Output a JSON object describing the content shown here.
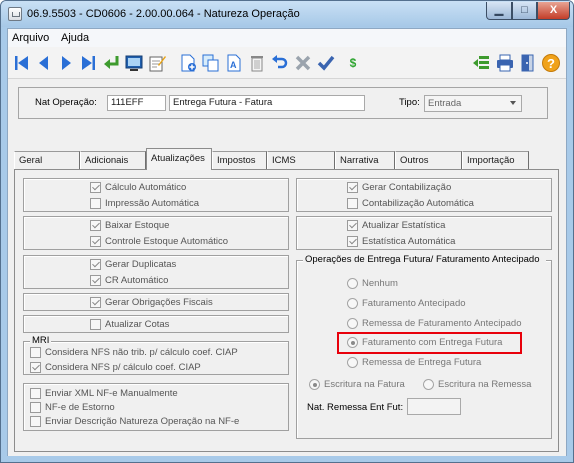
{
  "window": {
    "title": "06.9.5503 - CD0606 - 2.00.00.064 - Natureza Operação",
    "min_glyph": "▁",
    "max_glyph": "□",
    "close_glyph": "X"
  },
  "menu": {
    "arquivo": "Arquivo",
    "ajuda": "Ajuda"
  },
  "toolbar": {
    "icons": [
      "first-icon",
      "prev-icon",
      "next-icon",
      "last-icon",
      "return-icon",
      "screen-icon",
      "edit-icon",
      "new-icon",
      "copy-icon",
      "text-edit-icon",
      "delete-icon",
      "undo-icon",
      "cancel-icon",
      "confirm-icon",
      "currency-icon",
      "grid-icon",
      "print-icon",
      "exit-icon",
      "help-icon"
    ],
    "currency_glyph": "$",
    "help_glyph": "?"
  },
  "header": {
    "nat_label": "Nat Operação:",
    "nat_code": "111EFF",
    "nat_desc": "Entrega Futura - Fatura",
    "tipo_label": "Tipo:",
    "tipo_value": "Entrada"
  },
  "tabs": [
    "Geral",
    "Adicionais",
    "Atualizações",
    "Impostos",
    "ICMS",
    "Narrativa",
    "Outros",
    "Importação"
  ],
  "active_tab": "Atualizações",
  "left": {
    "calc_auto": "Cálculo Automático",
    "impressao_auto": "Impressão Automática",
    "baixar_estoque": "Baixar Estoque",
    "controle_estoque": "Controle Estoque Automático",
    "gerar_duplicatas": "Gerar Duplicatas",
    "cr_auto": "CR Automático",
    "gerar_obrigacoes": "Gerar Obrigações Fiscais",
    "atualizar_cotas": "Atualizar Cotas",
    "mri_title": "MRI",
    "mri_nfs_nao": "Considera NFS não trib. p/ cálculo coef. CIAP",
    "mri_nfs": "Considera NFS p/ cálculo coef. CIAP",
    "enviar_xml": "Enviar XML NF-e Manualmente",
    "nfe_estorno": "NF-e de Estorno",
    "enviar_desc": "Enviar Descrição Natureza Operação na NF-e"
  },
  "right": {
    "gerar_contab": "Gerar Contabilização",
    "contab_auto": "Contabilização Automática",
    "atualizar_estat": "Atualizar Estatística",
    "estat_auto": "Estatística Automática",
    "ops_title": "Operações de Entrega Futura/ Faturamento Antecipado",
    "nenhum": "Nenhum",
    "fat_antecipado": "Faturamento Antecipado",
    "remessa_fat_ant": "Remessa de Faturamento Antecipado",
    "fat_entrega_futura": "Faturamento com Entrega Futura",
    "remessa_entrega_futura": "Remessa de Entrega Futura",
    "escr_fatura": "Escritura na Fatura",
    "escr_remessa": "Escritura na Remessa",
    "nat_remessa_label": "Nat. Remessa Ent Fut:",
    "nat_remessa_value": ""
  },
  "colors": {
    "highlight": "#e8000b",
    "toolbar_blue": "#2a6fd6"
  }
}
